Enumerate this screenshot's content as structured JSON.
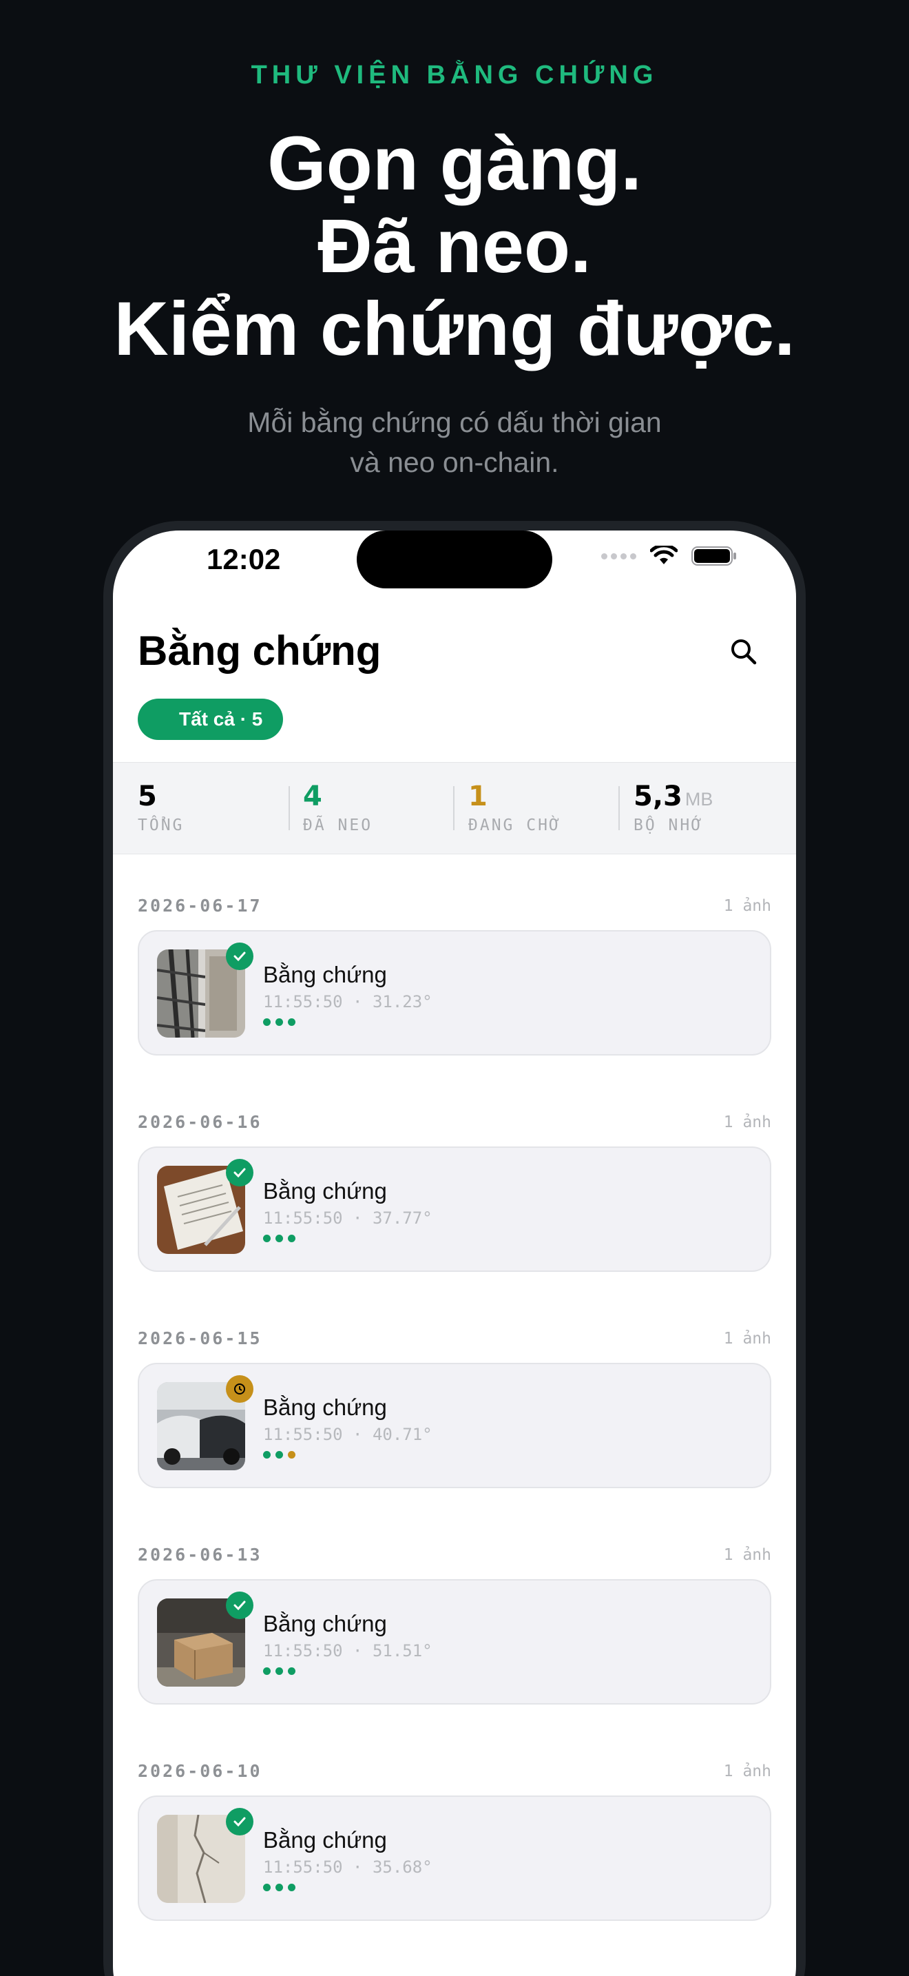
{
  "hero": {
    "eyebrow": "THƯ VIỆN BẰNG CHỨNG",
    "headline": [
      "Gọn gàng.",
      "Đã neo.",
      "Kiểm chứng được."
    ],
    "subtitle": [
      "Mỗi bằng chứng có dấu thời gian",
      "và neo on-chain."
    ]
  },
  "status_bar": {
    "time": "12:02"
  },
  "app": {
    "title": "Bằng chứng",
    "filter_chip": "Tất cả · 5",
    "stats": [
      {
        "value": "5",
        "unit": "",
        "label": "TỔNG",
        "color": "#000000"
      },
      {
        "value": "4",
        "unit": "",
        "label": "ĐÃ NEO",
        "color": "#0f9d63"
      },
      {
        "value": "1",
        "unit": "",
        "label": "ĐANG CHỜ",
        "color": "#c6901a"
      },
      {
        "value": "5,3",
        "unit": "MB",
        "label": "BỘ NHỚ",
        "color": "#000000"
      }
    ],
    "sections": [
      {
        "date": "2026-06-17",
        "count": "1 ảnh",
        "item": {
          "title": "Bằng chứng",
          "meta": "11:55:50 · 31.23°",
          "status": "anchored",
          "thumb": "scaffold"
        }
      },
      {
        "date": "2026-06-16",
        "count": "1 ảnh",
        "item": {
          "title": "Bằng chứng",
          "meta": "11:55:50 · 37.77°",
          "status": "anchored",
          "thumb": "document"
        }
      },
      {
        "date": "2026-06-15",
        "count": "1 ảnh",
        "item": {
          "title": "Bằng chứng",
          "meta": "11:55:50 · 40.71°",
          "status": "pending",
          "thumb": "car-crash"
        }
      },
      {
        "date": "2026-06-13",
        "count": "1 ảnh",
        "item": {
          "title": "Bằng chứng",
          "meta": "11:55:50 · 51.51°",
          "status": "anchored",
          "thumb": "box"
        }
      },
      {
        "date": "2026-06-10",
        "count": "1 ảnh",
        "item": {
          "title": "Bằng chứng",
          "meta": "11:55:50 · 35.68°",
          "status": "anchored",
          "thumb": "wall-crack"
        }
      }
    ]
  },
  "colors": {
    "accent": "#0f9d63",
    "pending": "#c6901a",
    "eyebrow": "#1fba7e"
  }
}
